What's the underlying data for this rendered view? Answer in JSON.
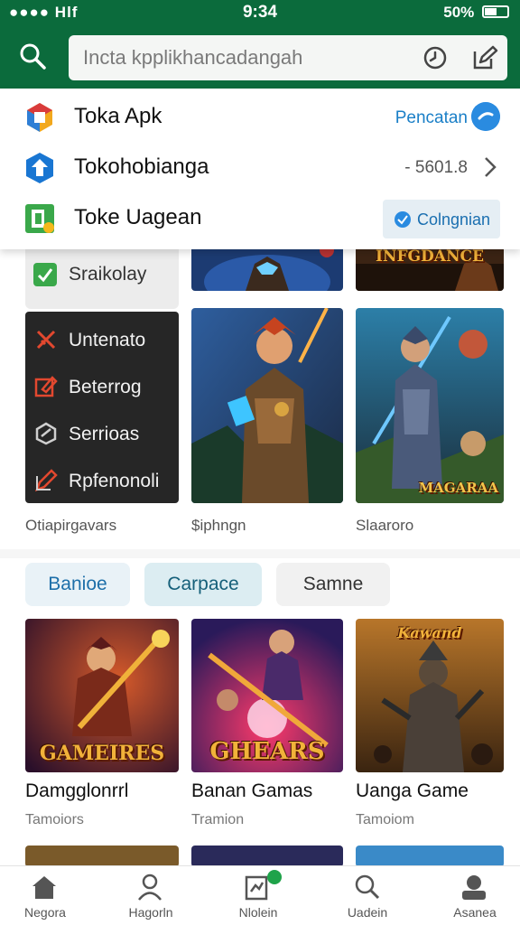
{
  "status_bar": {
    "signal": "●●●● Hlf",
    "time": "9:34",
    "battery": "50%"
  },
  "search": {
    "placeholder": "Incta kpplikhancadangah"
  },
  "suggestions": [
    {
      "name": "Toka Apk",
      "action": "Pencatan"
    },
    {
      "name": "Tokohobianga",
      "size": "- 5601.8"
    },
    {
      "name": "Toke Uagean",
      "button": "Colngnian"
    }
  ],
  "categories": {
    "top": "Sraikolay",
    "items": [
      "Untenato",
      "Beterrog",
      "Serrioas",
      "Rpfenonoli"
    ]
  },
  "banners": {
    "top_right_title": "INFGDANCE",
    "hero_right_badge": "MAGARAA"
  },
  "captions": [
    "Otiapirgavars",
    "$iphngn",
    "Slaaroro"
  ],
  "chips": [
    "Banioe",
    "Carpace",
    "Samne"
  ],
  "games": [
    {
      "art_title": "GAMEIRES",
      "title": "Damgglonrrl",
      "subtitle": "Tamoiors"
    },
    {
      "art_title": "GHEARS",
      "title": "Banan Gamas",
      "subtitle": "Tramion"
    },
    {
      "art_title": "Kawand",
      "title": "Uanga Game",
      "subtitle": "Tamoiom"
    }
  ],
  "bottom_nav": [
    "Negora",
    "Hagorln",
    "Nlolein",
    "Uadein",
    "Asanea"
  ],
  "colors": {
    "header": "#0b6b3c",
    "accent": "#2a8be0"
  }
}
